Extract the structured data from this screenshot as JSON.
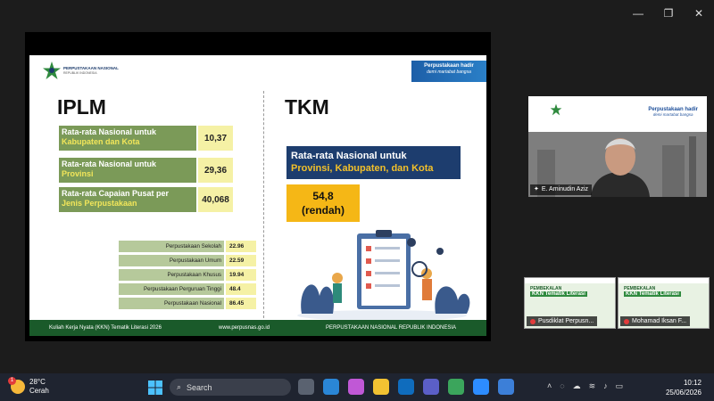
{
  "window": {
    "minimize": "—",
    "restore": "❐",
    "close": "✕"
  },
  "slide": {
    "logo_text": "PERPUSTAKAAN NASIONAL",
    "logo_sub": "REPUBLIK INDONESIA",
    "tagline_1": "Perpustakaan hadir",
    "tagline_2": "demi martabat bangsa",
    "iplm_title": "IPLM",
    "tkm_title": "TKM",
    "iplm_groups": [
      {
        "label_1": "Rata-rata Nasional untuk",
        "label_2": "Kabupaten dan Kota",
        "value": "10,37"
      },
      {
        "label_1": "Rata-rata Nasional untuk",
        "label_2": "Provinsi",
        "value": "29,36"
      },
      {
        "label_1": "Rata-rata Capaian Pusat per",
        "label_2": "Jenis Perpustakaan",
        "value": "40,068"
      }
    ],
    "sub_items": [
      {
        "label": "Perpustakaan Sekolah",
        "value": "22.96"
      },
      {
        "label": "Perpustakaan Umum",
        "value": "22.59"
      },
      {
        "label": "Perpustakaan Khusus",
        "value": "19.94"
      },
      {
        "label": "Perpustakaan Perguruan Tinggi",
        "value": "48.4"
      },
      {
        "label": "Perpustakaan Nasional",
        "value": "86.45"
      }
    ],
    "tkm_label_1": "Rata-rata Nasional untuk",
    "tkm_label_2": "Provinsi, Kabupaten, dan Kota",
    "tkm_value": "54,8",
    "tkm_value_note": "(rendah)",
    "footer_left": "Kuliah Kerja Nyata (KKN) Tematik Literasi 2026",
    "footer_mid": "www.perpusnas.go.id",
    "footer_right": "PERPUSTAKAAN NASIONAL REPUBLIK INDONESIA"
  },
  "camera": {
    "tagline_1": "Perpustakaan hadir",
    "tagline_2": "demi martabat bangsa",
    "name": "E. Aminudin Aziz"
  },
  "participants": [
    {
      "title_1": "PEMBEKALAN",
      "title_2": "KKN Tematik Literasi",
      "name": "Pusdiklat Perpusn..."
    },
    {
      "title_1": "PEMBEKALAN",
      "title_2": "KKN Tematik Literasi",
      "name": "Mohamad Iksan F..."
    }
  ],
  "taskbar": {
    "temperature": "28°C",
    "weather": "Cerah",
    "badge": "1",
    "search_placeholder": "Search",
    "time": "10:12",
    "date": "25/06/2026",
    "colors": {
      "accent": "#1d5fa8",
      "green": "#7b9a58",
      "yellow": "#f5f1a5",
      "orange": "#f5b716",
      "navy": "#1d3d6e"
    }
  }
}
